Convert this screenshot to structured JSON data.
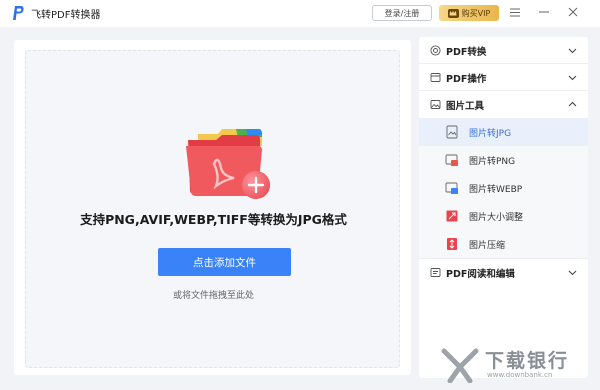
{
  "app": {
    "title": "飞转PDF转换器"
  },
  "titlebar": {
    "login_label": "登录/注册",
    "vip_label": "购买VIP",
    "vip_icon": "crown-icon",
    "window_controls": [
      "menu-icon",
      "minimize-icon",
      "close-icon"
    ]
  },
  "main": {
    "support_text": "支持PNG,AVIF,WEBP,TIFF等转换为JPG格式",
    "add_button_label": "点击添加文件",
    "drag_hint": "或将文件拖拽至此处",
    "colors": {
      "accent": "#3a82f7",
      "folder_red": "#e84848"
    }
  },
  "sidebar": {
    "sections": [
      {
        "label": "PDF转换",
        "icon": "convert-icon",
        "expanded": false
      },
      {
        "label": "PDF操作",
        "icon": "pdf-operate-icon",
        "expanded": false
      },
      {
        "label": "图片工具",
        "icon": "image-tools-icon",
        "expanded": true
      },
      {
        "label": "PDF阅读和编辑",
        "icon": "pdf-read-icon",
        "expanded": false
      }
    ],
    "image_tools": [
      {
        "label": "图片转JPG",
        "icon": "jpg-icon",
        "active": true
      },
      {
        "label": "图片转PNG",
        "icon": "png-icon",
        "active": false
      },
      {
        "label": "图片转WEBP",
        "icon": "webp-icon",
        "active": false
      },
      {
        "label": "图片大小调整",
        "icon": "resize-icon",
        "active": false
      },
      {
        "label": "图片压缩",
        "icon": "compress-icon",
        "active": false
      }
    ]
  },
  "watermark": {
    "text": "下载银行",
    "url": "www.downbank.cn"
  }
}
